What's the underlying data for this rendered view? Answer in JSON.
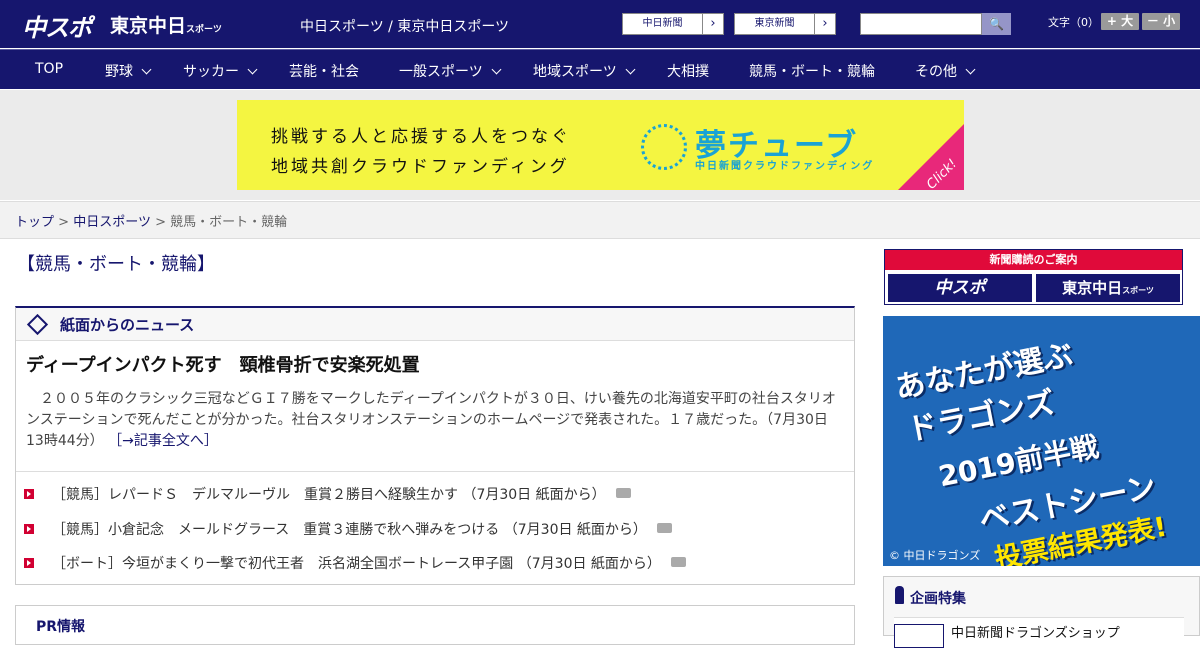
{
  "header": {
    "logo_chunichi": "中スポ",
    "logo_tokyo": "東京中日",
    "logo_tokyo_sub": "スポーツ",
    "site_name": "中日スポーツ / 東京中日スポーツ",
    "newspaper_links": [
      {
        "label": "中日新聞"
      },
      {
        "label": "東京新聞"
      }
    ],
    "search": {
      "placeholder": "",
      "value": ""
    },
    "font_size": {
      "label": "文字（0）",
      "larger": "+ 大",
      "smaller": "－ 小"
    }
  },
  "nav": {
    "items": [
      {
        "label": "TOP",
        "dropdown": false
      },
      {
        "label": "野球",
        "dropdown": true
      },
      {
        "label": "サッカー",
        "dropdown": true
      },
      {
        "label": "芸能・社会",
        "dropdown": false
      },
      {
        "label": "一般スポーツ",
        "dropdown": true
      },
      {
        "label": "地域スポーツ",
        "dropdown": true
      },
      {
        "label": "大相撲",
        "dropdown": false
      },
      {
        "label": "競馬・ボート・競輪",
        "dropdown": false
      },
      {
        "label": "その他",
        "dropdown": true
      }
    ]
  },
  "ad_banner": {
    "line1": "挑戦する人と応援する人をつなぐ",
    "line2": "地域共創クラウドファンディング",
    "brand": "夢チューブ",
    "brand_sub": "中日新聞クラウドファンディング",
    "click": "Click!",
    "colors": {
      "bg": "#f4f541",
      "accent": "#1aa3d4",
      "corner": "#e8287a"
    }
  },
  "breadcrumb": {
    "items": [
      "トップ",
      "中日スポーツ",
      "競馬・ボート・競輪"
    ],
    "separator": ">"
  },
  "page_title": "【競馬・ボート・競輪】",
  "news": {
    "section_title": "紙面からのニュース",
    "lead": {
      "headline": "ディープインパクト死す　頸椎骨折で安楽死処置",
      "body": "　２００５年のクラシック三冠などＧＩ７勝をマークしたディープインパクトが３０日、けい養先の北海道安平町の社台スタリオンステーションで死んだことが分かった。社台スタリオンステーションのホームページで発表された。１７歳だった。（7月30日 13時44分）",
      "more": "［→記事全文へ］"
    },
    "items": [
      {
        "text": "［競馬］レパードＳ　デルマルーヴル　重賞２勝目へ経験生かす （7月30日 紙面から）",
        "has_photo": true
      },
      {
        "text": "［競馬］小倉記念　メールドグラース　重賞３連勝で秋へ弾みをつける （7月30日 紙面から）",
        "has_photo": true
      },
      {
        "text": "［ボート］今垣がまくり一撃で初代王者　浜名湖全国ボートレース甲子園 （7月30日 紙面から）",
        "has_photo": true
      }
    ]
  },
  "pr": {
    "title": "PR情報"
  },
  "sidebar": {
    "subscribe": {
      "title": "新聞購読のご案内",
      "btn1": "中スポ",
      "btn2": "東京中日",
      "btn2_sub": "スポーツ"
    },
    "dragons_banner": {
      "lines": [
        "あなたが選ぶ",
        "ドラゴンズ",
        "2019前半戦",
        "ベストシーン",
        "投票結果発表!"
      ],
      "credit": "© 中日ドラゴンズ"
    },
    "special": {
      "title": "企画特集",
      "item": "中日新聞ドラゴンズショップ"
    }
  },
  "colors": {
    "brand": "#16166e",
    "red": "#d10032"
  }
}
